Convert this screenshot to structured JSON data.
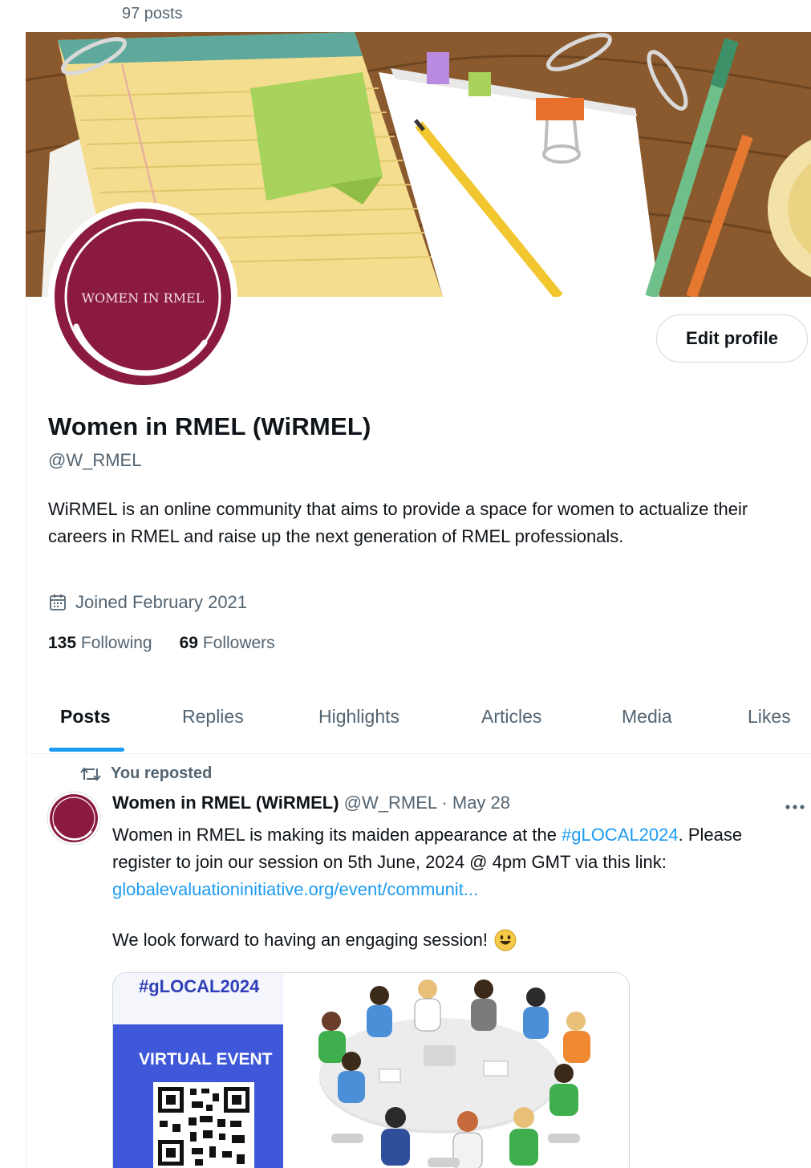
{
  "profile": {
    "post_count": "97 posts",
    "avatar_text": "WOMEN IN RMEL",
    "edit_profile_label": "Edit profile",
    "display_name": "Women in RMEL (WiRMEL)",
    "handle": "@W_RMEL",
    "bio": "WiRMEL is an online community that aims to provide a space for women to actualize their careers in RMEL and raise up the next generation of RMEL professionals.",
    "joined": "Joined February 2021",
    "following_count": "135",
    "following_label": "Following",
    "followers_count": "69",
    "followers_label": "Followers",
    "brand_color": "#8b1a40",
    "accent_color": "#1d9bf0"
  },
  "tabs": [
    {
      "label": "Posts",
      "active": true
    },
    {
      "label": "Replies",
      "active": false
    },
    {
      "label": "Highlights",
      "active": false
    },
    {
      "label": "Articles",
      "active": false
    },
    {
      "label": "Media",
      "active": false
    },
    {
      "label": "Likes",
      "active": false
    }
  ],
  "post": {
    "repost_label": "You reposted",
    "author_name": "Women in RMEL (WiRMEL)",
    "author_handle": "@W_RMEL",
    "separator": "·",
    "date": "May 28",
    "text_before_hashtag": "Women in RMEL is making its maiden appearance at the ",
    "hashtag": "#gLOCAL2024",
    "text_after_hashtag": ". Please register to join our session on 5th June, 2024 @ 4pm GMT via this link: ",
    "link_text": "globalevaluationinitiative.org/event/communit...",
    "text_line2": "We look forward to having an engaging session!",
    "media": {
      "hashtag": "#gLOCAL2024",
      "event_label": "VIRTUAL EVENT"
    }
  },
  "icons": {
    "calendar": "calendar-icon",
    "repost": "repost-icon",
    "more": "more-icon",
    "emoji": "smiley-emoji-icon"
  }
}
